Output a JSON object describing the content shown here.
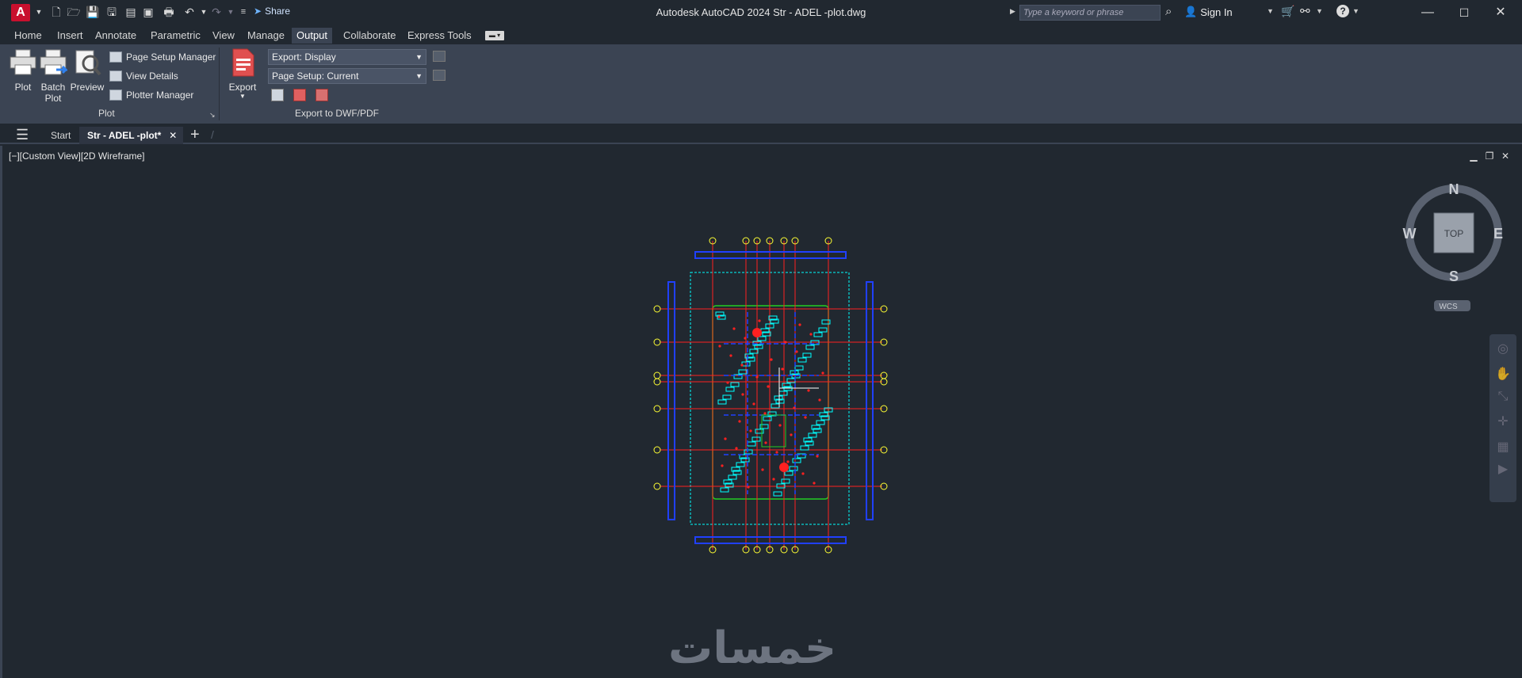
{
  "titlebar": {
    "app_letter": "A",
    "share_label": "Share",
    "title": "Autodesk AutoCAD 2024    Str - ADEL -plot.dwg",
    "search_placeholder": "Type a keyword or phrase",
    "sign_in": "Sign In"
  },
  "ribbon_tabs": [
    {
      "label": "Home"
    },
    {
      "label": "Insert"
    },
    {
      "label": "Annotate"
    },
    {
      "label": "Parametric"
    },
    {
      "label": "View"
    },
    {
      "label": "Manage"
    },
    {
      "label": "Output"
    },
    {
      "label": "Collaborate"
    },
    {
      "label": "Express Tools"
    }
  ],
  "active_tab": "Output",
  "plot_panel": {
    "plot": "Plot",
    "batch_plot_1": "Batch",
    "batch_plot_2": "Plot",
    "preview": "Preview",
    "page_setup_manager": "Page Setup Manager",
    "view_details": "View Details",
    "plotter_manager": "Plotter Manager",
    "panel_label": "Plot"
  },
  "export_panel": {
    "export": "Export",
    "export_display": "Export: Display",
    "page_setup": "Page Setup: Current",
    "panel_label": "Export to DWF/PDF"
  },
  "doc_tabs": {
    "start": "Start",
    "active": "Str - ADEL -plot*"
  },
  "viewport": {
    "label": "[−][Custom View][2D Wireframe]"
  },
  "viewcube": {
    "n": "N",
    "s": "S",
    "e": "E",
    "w": "W",
    "face": "TOP",
    "wcs": "WCS"
  },
  "watermark": "خمسات",
  "colors": {
    "background": "#212830",
    "ribbon": "#3b4453",
    "grid_red": "#ff2020",
    "cyan": "#00ffff",
    "blue": "#2040ff",
    "green": "#22cc22",
    "bubble_yellow": "#ffff33"
  }
}
